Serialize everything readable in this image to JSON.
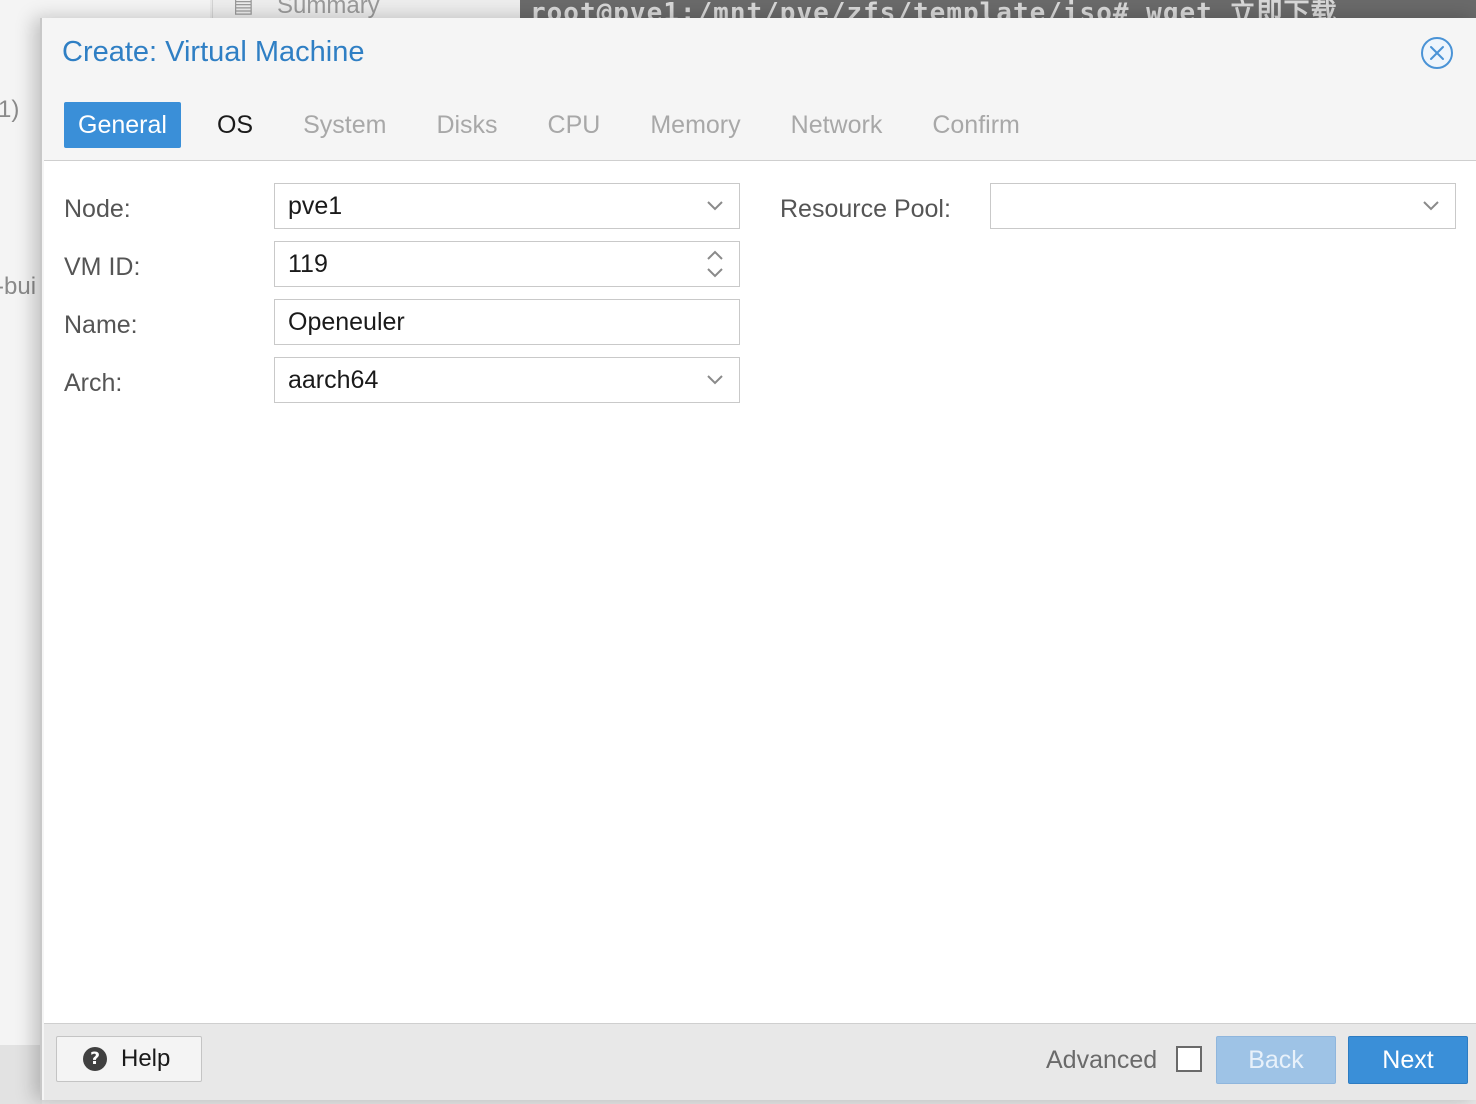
{
  "background": {
    "left_text_1": "1)",
    "left_text_2": "-bui",
    "nav_label": "Summary",
    "terminal_text": "root@pve1:/mnt/pve/zfs/template/iso# wget 立即下载"
  },
  "dialog": {
    "title": "Create: Virtual Machine",
    "close_icon": "close-circle-icon",
    "accent_color": "#3a8fd8"
  },
  "tabs": [
    {
      "label": "General",
      "state": "active"
    },
    {
      "label": "OS",
      "state": "enabled"
    },
    {
      "label": "System",
      "state": "disabled"
    },
    {
      "label": "Disks",
      "state": "disabled"
    },
    {
      "label": "CPU",
      "state": "disabled"
    },
    {
      "label": "Memory",
      "state": "disabled"
    },
    {
      "label": "Network",
      "state": "disabled"
    },
    {
      "label": "Confirm",
      "state": "disabled"
    }
  ],
  "form": {
    "node": {
      "label": "Node:",
      "value": "pve1"
    },
    "vmid": {
      "label": "VM ID:",
      "value": "119"
    },
    "name": {
      "label": "Name:",
      "value": "Openeuler"
    },
    "arch": {
      "label": "Arch:",
      "value": "aarch64"
    },
    "pool": {
      "label": "Resource Pool:",
      "value": ""
    }
  },
  "footer": {
    "help_label": "Help",
    "advanced_label": "Advanced",
    "advanced_checked": false,
    "back_label": "Back",
    "next_label": "Next"
  }
}
